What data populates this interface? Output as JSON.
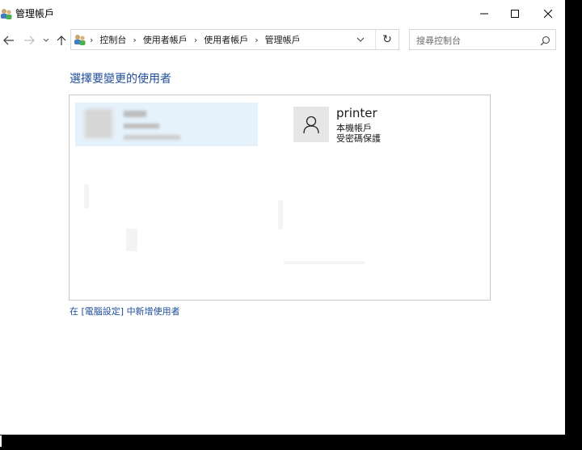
{
  "window": {
    "title": "管理帳戶"
  },
  "address": {
    "crumbs": [
      "控制台",
      "使用者帳戶",
      "使用者帳戶",
      "管理帳戶"
    ]
  },
  "search": {
    "placeholder": "搜尋控制台"
  },
  "main": {
    "heading": "選擇要變更的使用者",
    "accounts": [
      {
        "name": "printer",
        "type": "本機帳戶",
        "status": "受密碼保護"
      }
    ],
    "add_user_link": "在 [電腦設定] 中新增使用者"
  },
  "colors": {
    "link": "#1e4e9a",
    "selection": "#e5f1fb"
  },
  "icons": [
    "users-icon",
    "back-arrow-icon",
    "forward-arrow-icon",
    "recent-dropdown-icon",
    "up-arrow-icon",
    "chevron-right-icon",
    "refresh-icon",
    "search-icon",
    "user-avatar-icon",
    "minimize-icon",
    "maximize-icon",
    "close-icon"
  ]
}
